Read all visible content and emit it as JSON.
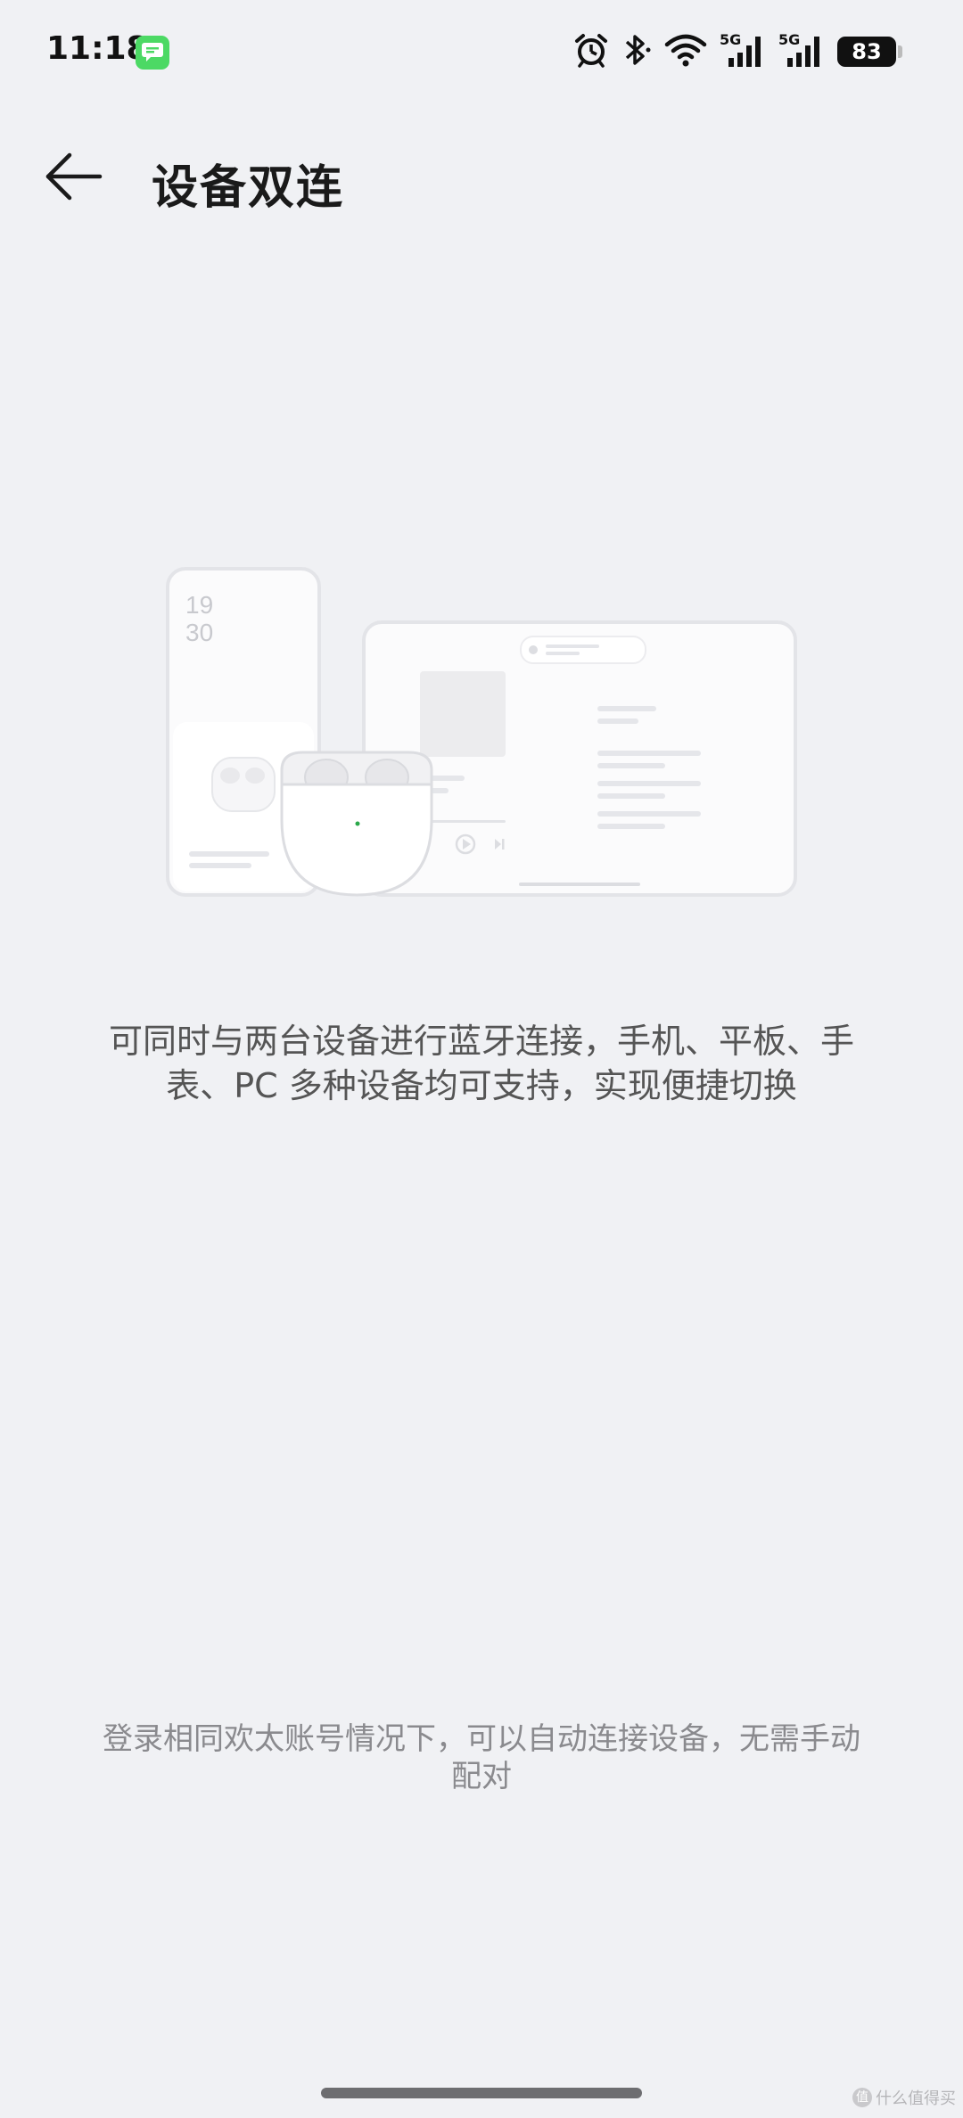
{
  "status_bar": {
    "time": "11:18",
    "signal_1_label": "5G",
    "signal_2_label": "5G",
    "battery": "83"
  },
  "header": {
    "title": "设备双连"
  },
  "illustration": {
    "phone_clock_hour": "19",
    "phone_clock_minute": "30"
  },
  "content": {
    "description_line1": "可同时与两台设备进行蓝牙连接，手机、平板、手",
    "description_line2": "表、PC 多种设备均可支持，实现便捷切换",
    "footnote_line1": "登录相同欢太账号情况下，可以自动连接设备，无需手动",
    "footnote_line2": "配对"
  },
  "watermark": {
    "text": "什么值得买",
    "logo": "值"
  },
  "colors": {
    "background": "#f0f1f4",
    "message_app": "#4cd964",
    "earbud_led": "#2aa84a"
  }
}
